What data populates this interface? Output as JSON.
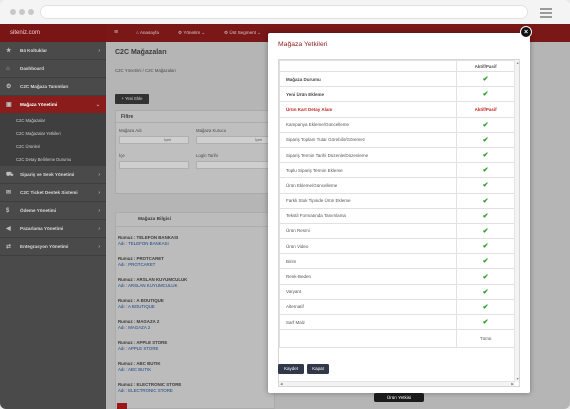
{
  "topbar": {
    "site": "siteniz.com",
    "links": [
      "Anasayfa",
      "Yönetim",
      "Üst Segment"
    ]
  },
  "sidebar": {
    "items": [
      {
        "label": "B4 Koltuklar",
        "icon": "star-icon",
        "active": false
      },
      {
        "label": "Dashboard",
        "icon": "home-icon",
        "active": false
      },
      {
        "label": "C2C Mağaza Tanımları",
        "icon": "gear-icon",
        "active": false
      },
      {
        "label": "Mağaza Yönetimi",
        "icon": "store-icon",
        "active": true
      }
    ],
    "subitems": [
      "C2C Mağazalar",
      "C2C Mağazalar Yetkileri",
      "C2C Ürünleri",
      "C2C Detay Belirleme Durumu"
    ],
    "more_items": [
      {
        "label": "Sipariş ve Sevk Yönetimi",
        "icon": "truck-icon"
      },
      {
        "label": "C2C Ticket Destek Sistemi",
        "icon": "ticket-icon"
      },
      {
        "label": "Ödeme Yönetimi",
        "icon": "payment-icon"
      },
      {
        "label": "Pazarlama Yönetimi",
        "icon": "megaphone-icon"
      },
      {
        "label": "Entegrasyon Yönetimi",
        "icon": "link-icon"
      }
    ]
  },
  "main": {
    "title": "C2C Mağazaları",
    "breadcrumb": "C2C Yönetimi / C2C Mağazaları",
    "new_button": "+ Yeni Ekle",
    "filter": {
      "heading": "Filtre",
      "labels": [
        "Mağaza Adı",
        "Mağaza Kurucu",
        "İçe",
        "Login Tarihi"
      ],
      "select_placeholder": "İçeri"
    },
    "store_info": {
      "heading": "Mağaza Bilgisi",
      "stores": [
        {
          "name": "Rumuz : TELEFON BANKASI",
          "alias": "Adı : TELEFON BANKASI"
        },
        {
          "name": "Rumuz : PROTCARET",
          "alias": "Adı : PROTCARET"
        },
        {
          "name": "Rumuz : ARSLAN KUYUMCULUK",
          "alias": "Adı : ARSLAN KUYUMCULUK"
        },
        {
          "name": "Rumuz : A BOUTIQUE",
          "alias": "Adı : A BOUTIQUE"
        },
        {
          "name": "Rumuz : MAGAZA 2",
          "alias": "Adı : MAGAZA 2"
        },
        {
          "name": "Rumuz : APPLE STORE",
          "alias": "Adı : APPLE STORE"
        },
        {
          "name": "Rumuz : ABC BUTIK",
          "alias": "Adı : ABC BUTIK"
        },
        {
          "name": "Rumuz : ELECTRONIC STORE",
          "alias": "Adı : ELECTRONIC STORE"
        }
      ]
    }
  },
  "modal": {
    "title": "Mağaza Yetkileri",
    "column_header": "Aktif/Pasif",
    "rows": [
      {
        "label": "Mağaza Durumu",
        "style": "bold",
        "value": "check"
      },
      {
        "label": "Yeni Ürün Ekleme",
        "style": "bold",
        "value": "check"
      },
      {
        "label": "Ürün Kart Detay Alanı",
        "style": "red",
        "value": "Aktif/Pasif"
      },
      {
        "label": "Kampanya Ekleme/Güncelleme",
        "style": "normal",
        "value": "check"
      },
      {
        "label": "Sipariş Toplam Tutar Görebilir/Göremez",
        "style": "normal",
        "value": "check"
      },
      {
        "label": "Sipariş Termin Tarihi Düzenle/Düzenleme",
        "style": "normal",
        "value": "check"
      },
      {
        "label": "Toplu Sipariş Termin Ekleme",
        "style": "normal",
        "value": "check"
      },
      {
        "label": "Ürün Ekleme/Güncelleme",
        "style": "normal",
        "value": "check"
      },
      {
        "label": "Farklı Stok Tipinde Ürün Ekleme",
        "style": "normal",
        "value": "check"
      },
      {
        "label": "Tekstil Formatında Tanımlama",
        "style": "normal",
        "value": "check"
      },
      {
        "label": "Ürün Resmi",
        "style": "normal",
        "value": "check"
      },
      {
        "label": "Ürün Video",
        "style": "normal",
        "value": "check"
      },
      {
        "label": "Birim",
        "style": "normal",
        "value": "check"
      },
      {
        "label": "Renk-Beden",
        "style": "normal",
        "value": "check"
      },
      {
        "label": "Varyant",
        "style": "normal",
        "value": "check"
      },
      {
        "label": "Alternatif",
        "style": "normal",
        "value": "check"
      },
      {
        "label": "Sarf Malz",
        "style": "normal",
        "value": "check"
      }
    ],
    "footer_label": "Tümü",
    "save_label": "Kaydet",
    "close_label": "Kapat",
    "close_x": "×"
  },
  "tooltip": "Ürün Yetkisi",
  "colors": {
    "accent": "#8b1c1c",
    "check": "#2c9a2c",
    "button": "#31384a"
  }
}
